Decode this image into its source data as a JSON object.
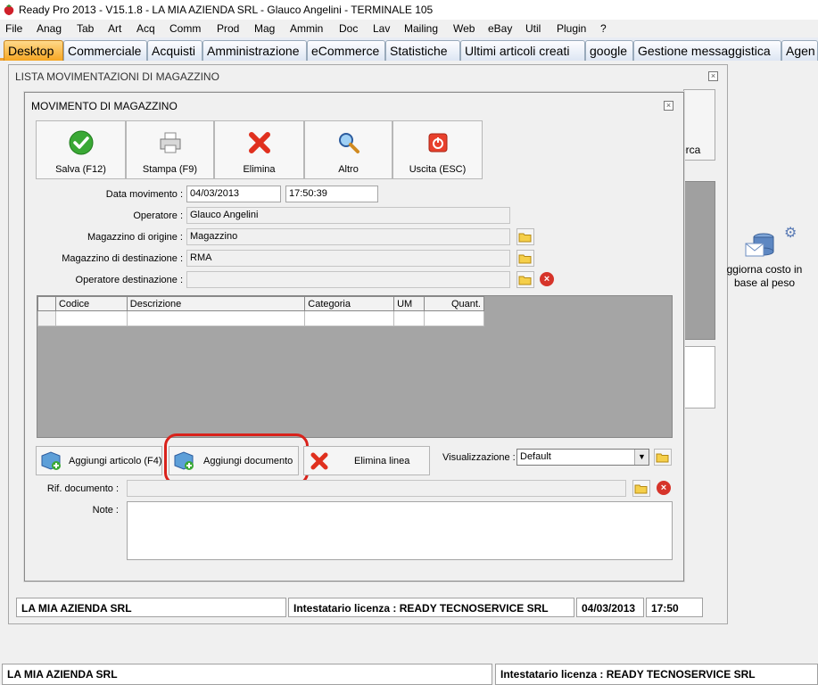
{
  "window": {
    "title": "Ready Pro 2013 - V15.1.8 - LA MIA AZIENDA SRL - Glauco Angelini - TERMINALE 105"
  },
  "menu": [
    "File",
    "Anag",
    "Tab",
    "Art",
    "Acq",
    "Comm",
    "Prod",
    "Mag",
    "Ammin",
    "Doc",
    "Lav",
    "Mailing",
    "Web",
    "eBay",
    "Util",
    "Plugin",
    "?"
  ],
  "tabs": [
    "Desktop",
    "Commerciale",
    "Acquisti",
    "Amministrazione",
    "eCommerce",
    "Statistiche",
    "Ultimi articoli creati",
    "google",
    "Gestione messaggistica",
    "Agen"
  ],
  "list_window": {
    "title": "LISTA MOVIMENTAZIONI DI MAGAZZINO",
    "bg_button_label": "erca",
    "status": {
      "company": "LA MIA AZIENDA SRL",
      "license": "Intestatario licenza : READY TECNOSERVICE SRL",
      "date": "04/03/2013",
      "time": "17:50"
    }
  },
  "desktop_shortcut": {
    "label_line1": "ggiorna costo in",
    "label_line2": "base al peso"
  },
  "dialog": {
    "title": "MOVIMENTO DI MAGAZZINO",
    "toolbar": {
      "save": "Salva (F12)",
      "print": "Stampa (F9)",
      "delete": "Elimina",
      "other": "Altro",
      "exit": "Uscita (ESC)"
    },
    "fields": {
      "date_label": "Data movimento :",
      "date_value": "04/03/2013",
      "time_value": "17:50:39",
      "operator_label": "Operatore :",
      "operator_value": "Glauco Angelini",
      "origin_label": "Magazzino di origine :",
      "origin_value": "Magazzino",
      "dest_label": "Magazzino di destinazione :",
      "dest_value": "RMA",
      "dest_operator_label": "Operatore destinazione :",
      "dest_operator_value": ""
    },
    "grid": {
      "columns": [
        "Codice",
        "Descrizione",
        "Categoria",
        "UM",
        "Quant."
      ]
    },
    "actions": {
      "add_article": "Aggiungi articolo (F4)",
      "add_document": "Aggiungi documento",
      "delete_line": "Elimina linea",
      "view_label": "Visualizzazione :",
      "view_value": "Default"
    },
    "doc_ref_label": "Rif. documento :",
    "notes_label": "Note :"
  },
  "main_status": {
    "company": "LA MIA AZIENDA SRL",
    "license": "Intestatario licenza : READY TECNOSERVICE SRL"
  },
  "colors": {
    "active_tab": "#f6a623",
    "highlight": "#d9221b"
  }
}
